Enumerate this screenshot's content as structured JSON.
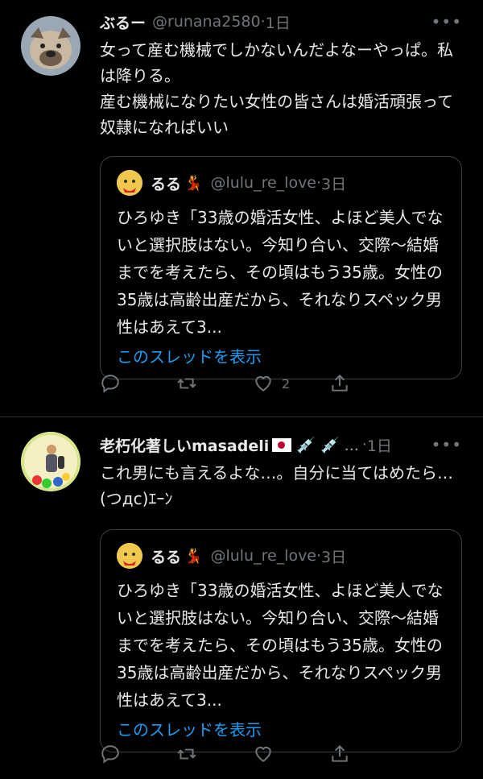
{
  "tweets": [
    {
      "name": "ぶるー",
      "handle": "@runana2580",
      "dot": "·",
      "time": "1日",
      "text": "女って産む機械でしかないんだよなーやっぱ。私は降りる。\n産む機械になりたい女性の皆さんは婚活頑張って奴隷になればいい",
      "quote": {
        "name": "るる",
        "emoji": "💃",
        "handle": "@lulu_re_love",
        "dot": "·",
        "time": "3日",
        "text": "ひろゆき「33歳の婚活女性、よほど美人でないと選択肢はない。今知り合い、交際〜結婚までを考えたら、その頃はもう35歳。女性の35歳は高齢出産だから、それなりスペック男性はあえて3...",
        "thread_link": "このスレッドを表示"
      },
      "actions": {
        "reply": "",
        "retweet": "",
        "like": "2",
        "share": ""
      }
    },
    {
      "name": "老朽化著しいmasadeli",
      "name_suffix": "💉 💉 ...",
      "dot": "·",
      "time": "1日",
      "text": "これ男にも言えるよな…。自分に当てはめたら…(つдc)ｴｰﾝ",
      "quote": {
        "name": "るる",
        "emoji": "💃",
        "handle": "@lulu_re_love",
        "dot": "·",
        "time": "3日",
        "text": "ひろゆき「33歳の婚活女性、よほど美人でないと選択肢はない。今知り合い、交際〜結婚までを考えたら、その頃はもう35歳。女性の35歳は高齢出産だから、それなりスペック男性はあえて3...",
        "thread_link": "このスレッドを表示"
      }
    }
  ],
  "more_icon": "•••"
}
